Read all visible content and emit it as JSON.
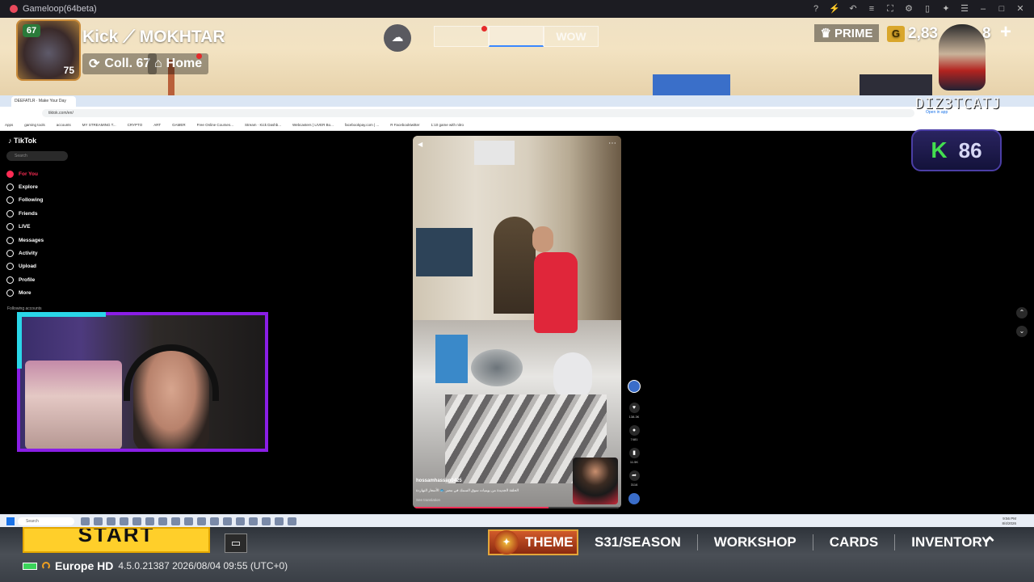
{
  "emulator": {
    "title": "Gameloop(64beta)"
  },
  "hud": {
    "player_name": "Kick ⟋ MOKHTAR",
    "avatar_level": "67",
    "avatar_badge_num": "75",
    "collection": "Coll. 67",
    "home": "Home",
    "mode_tabs": [
      "",
      "",
      "WOW"
    ],
    "prime": "PRIME",
    "currency_label": "G",
    "currency_amount": "2,83",
    "currency_extra": "8",
    "glitch_text": "DIZ3TCATJ"
  },
  "browser": {
    "tab_title": "DEEFATLR · Make Your Day",
    "url": "tiktok.com/en/",
    "bookmarks": [
      "Apps",
      "gaming tools",
      "accounts",
      "MY STREAMING T...",
      "CRYPTO",
      "ART",
      "GAMER",
      "Free Online Courses...",
      "Stream · Kick Dashb...",
      "Webcasters | LIVER Bo...",
      "facebookpay.com | ...",
      "R Facebooktwitter",
      "1:10 game with nitro"
    ],
    "open_app": "Open in app"
  },
  "tiktok": {
    "logo": "TikTok",
    "search_placeholder": "Search",
    "nav": [
      {
        "label": "For You",
        "active": true
      },
      {
        "label": "Explore",
        "active": false
      },
      {
        "label": "Following",
        "active": false
      },
      {
        "label": "Friends",
        "active": false
      },
      {
        "label": "LIVE",
        "active": false
      },
      {
        "label": "Messages",
        "active": false
      },
      {
        "label": "Activity",
        "active": false
      },
      {
        "label": "Upload",
        "active": false
      },
      {
        "label": "Profile",
        "active": false
      },
      {
        "label": "More",
        "active": false
      }
    ],
    "following_title": "Following accounts",
    "video": {
      "author": "hossamhassan0425",
      "caption": "الحلقة الجديدة من يوميات سوق السمك في مصر 🐟 الأسعار النهاردة",
      "translation": "See translation",
      "progress_fraction": 0.65
    },
    "actions": [
      {
        "icon": "heart-icon",
        "count": "138.3K"
      },
      {
        "icon": "comment-icon",
        "count": "7481"
      },
      {
        "icon": "bookmark-icon",
        "count": "11.5K"
      },
      {
        "icon": "share-icon",
        "count": "3116"
      }
    ]
  },
  "kick_badge": {
    "letter": "K",
    "count": "86"
  },
  "taskbar": {
    "search_placeholder": "Search",
    "clock_time": "9:56 PM",
    "clock_date": "8/4/2026"
  },
  "game_bottom": {
    "start": "START",
    "server": "Europe HD",
    "version": "4.5.0.21387 2026/08/04 09:55 (UTC+0)",
    "menu": [
      "THEME",
      "S31/SEASON",
      "WORKSHOP",
      "CARDS",
      "INVENTORY"
    ]
  }
}
